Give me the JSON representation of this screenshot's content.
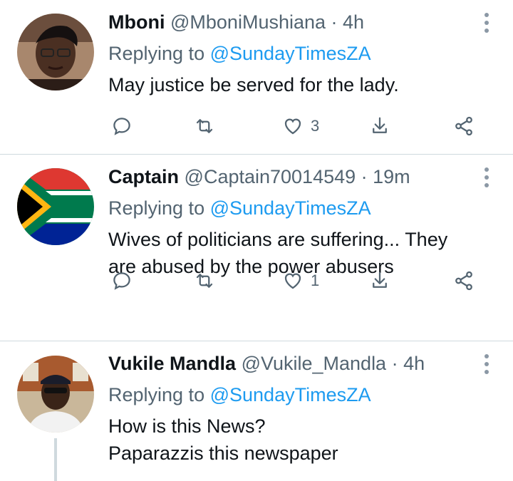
{
  "tweets": [
    {
      "name": "Mboni",
      "handle": "@MboniMushiana",
      "time": "· 4h",
      "replying_label": "Replying to",
      "replying_handle": "@SundayTimesZA",
      "text": "May justice be served for the lady.",
      "likes": "3"
    },
    {
      "name": "Captain",
      "handle": "@Captain70014549",
      "time": "· 19m",
      "replying_label": "Replying to",
      "replying_handle": "@SundayTimesZA",
      "text_line1": "Wives of politicians are suffering... They",
      "text_line2": "are abused by the power abusers",
      "likes": "1"
    },
    {
      "name": "Vukile Mandla",
      "handle": "@Vukile_Mandla",
      "time": "· 4h",
      "replying_label": "Replying to",
      "replying_handle": "@SundayTimesZA",
      "text_line1": "How is this News?",
      "text_line2": "Paparazzis this newspaper"
    }
  ],
  "icons": {
    "reply": "reply-icon",
    "retweet": "retweet-icon",
    "like": "heart-icon",
    "share": "share-icon",
    "more": "more-options-icon",
    "extra": "share-network-icon"
  },
  "colors": {
    "link": "#1d9bf0",
    "muted": "#536471",
    "text": "#0f1419",
    "divider": "#cfd9de"
  }
}
